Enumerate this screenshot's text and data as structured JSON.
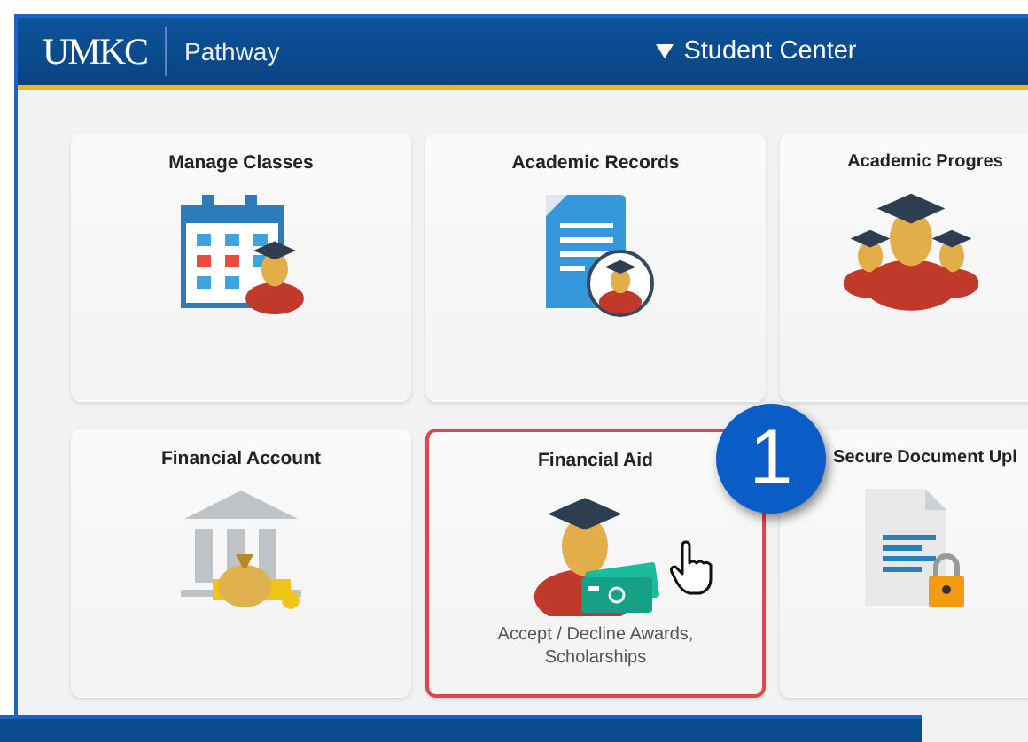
{
  "header": {
    "logo": "UMKC",
    "app_name": "Pathway",
    "menu_title": "Student Center"
  },
  "tiles": [
    {
      "title": "Manage Classes",
      "kind": "calendar",
      "selected": false
    },
    {
      "title": "Academic Records",
      "kind": "records",
      "selected": false
    },
    {
      "title": "Academic Progres",
      "kind": "progress",
      "selected": false
    },
    {
      "title": "Financial Account",
      "kind": "bank",
      "selected": false
    },
    {
      "title": "Financial Aid",
      "kind": "aid",
      "subtitle": "Accept / Decline Awards, Scholarships",
      "selected": true
    },
    {
      "title": "Secure Document Upl",
      "kind": "upload",
      "selected": false
    }
  ],
  "step_badge": "1"
}
